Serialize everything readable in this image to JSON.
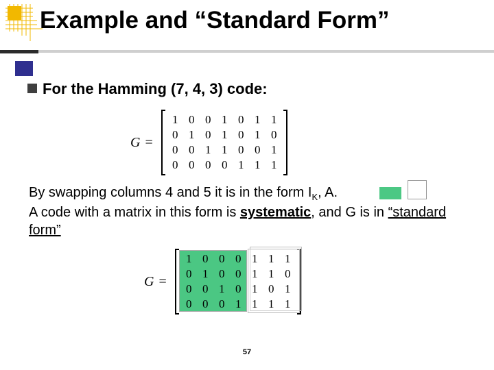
{
  "title": "Example and “Standard Form”",
  "bullet1": "For the Hamming (7, 4, 3) code:",
  "matrix_symbol": "G",
  "equals": "=",
  "matrix1": {
    "rows": [
      [
        "1",
        "0",
        "0",
        "1",
        "0",
        "1",
        "1"
      ],
      [
        "0",
        "1",
        "0",
        "1",
        "0",
        "1",
        "0"
      ],
      [
        "0",
        "0",
        "1",
        "1",
        "0",
        "0",
        "1"
      ],
      [
        "0",
        "0",
        "0",
        "0",
        "1",
        "1",
        "1"
      ]
    ]
  },
  "para1_a": "By swapping columns 4 and 5 it is in the form ",
  "para1_ik": "I",
  "para1_iksub": "K",
  "para1_comma": ", ",
  "para1_A": "A.",
  "para1_b": "A code with a matrix in this form is ",
  "para1_sys": "systematic",
  "para1_c": ", and G is in ",
  "para1_std": "“standard form”",
  "matrix2": {
    "rows": [
      [
        "1",
        "0",
        "0",
        "0",
        "1",
        "1",
        "1"
      ],
      [
        "0",
        "1",
        "0",
        "0",
        "1",
        "1",
        "0"
      ],
      [
        "0",
        "0",
        "1",
        "0",
        "1",
        "0",
        "1"
      ],
      [
        "0",
        "0",
        "0",
        "1",
        "1",
        "1",
        "1"
      ]
    ]
  },
  "pagenum": "57"
}
